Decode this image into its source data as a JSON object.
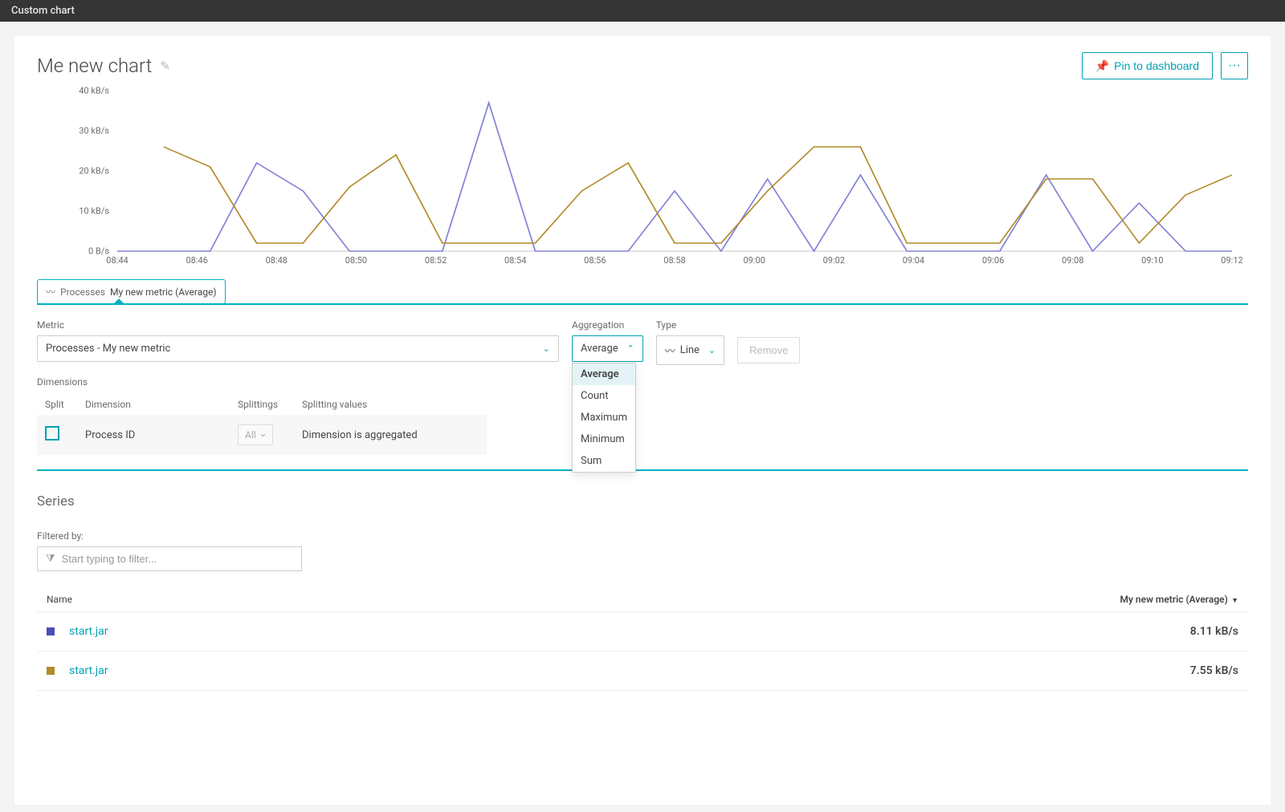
{
  "topbar": {
    "title": "Custom chart"
  },
  "header": {
    "chart_title": "Me new chart",
    "pin_label": "Pin to dashboard",
    "more_label": "···"
  },
  "pill": {
    "prefix": "Processes",
    "main": "My new metric (Average)"
  },
  "config": {
    "metric_label": "Metric",
    "metric_value": "Processes - My new metric",
    "aggregation_label": "Aggregation",
    "aggregation_value": "Average",
    "aggregation_options": [
      "Average",
      "Count",
      "Maximum",
      "Minimum",
      "Sum"
    ],
    "type_label": "Type",
    "type_value": "Line",
    "remove_label": "Remove"
  },
  "dimensions": {
    "label": "Dimensions",
    "headers": {
      "split": "Split",
      "dimension": "Dimension",
      "splittings": "Splittings",
      "values": "Splitting values"
    },
    "row": {
      "dimension": "Process ID",
      "splittings": "All",
      "values": "Dimension is aggregated"
    }
  },
  "series": {
    "heading": "Series",
    "filtered_by": "Filtered by:",
    "filter_placeholder": "Start typing to filter...",
    "columns": {
      "name": "Name",
      "metric": "My new metric (Average)"
    },
    "rows": [
      {
        "color": "#4b4db3",
        "name": "start.jar",
        "value": "8.11 kB/s"
      },
      {
        "color": "#b38a29",
        "name": "start.jar",
        "value": "7.55 kB/s"
      }
    ]
  },
  "chart_data": {
    "type": "line",
    "ylabel": "kB/s",
    "ylim": [
      0,
      40
    ],
    "y_ticks": [
      "0 B/s",
      "10 kB/s",
      "20 kB/s",
      "30 kB/s",
      "40 kB/s"
    ],
    "x_categories": [
      "08:44",
      "08:46",
      "08:48",
      "08:50",
      "08:52",
      "08:54",
      "08:56",
      "08:58",
      "09:00",
      "09:02",
      "09:04",
      "09:06",
      "09:08",
      "09:10",
      "09:12"
    ],
    "series": [
      {
        "name": "start.jar",
        "color": "#8282d8",
        "values": [
          0,
          0,
          0,
          22,
          15,
          0,
          0,
          0,
          37,
          0,
          0,
          0,
          15,
          0,
          18,
          0,
          19,
          0,
          0,
          0,
          19,
          0,
          12,
          0,
          0
        ]
      },
      {
        "name": "start.jar",
        "color": "#b38a29",
        "values": [
          null,
          26,
          21,
          2,
          2,
          16,
          24,
          2,
          2,
          2,
          15,
          22,
          2,
          2,
          15,
          26,
          26,
          2,
          2,
          2,
          18,
          18,
          2,
          14,
          19
        ]
      }
    ]
  }
}
